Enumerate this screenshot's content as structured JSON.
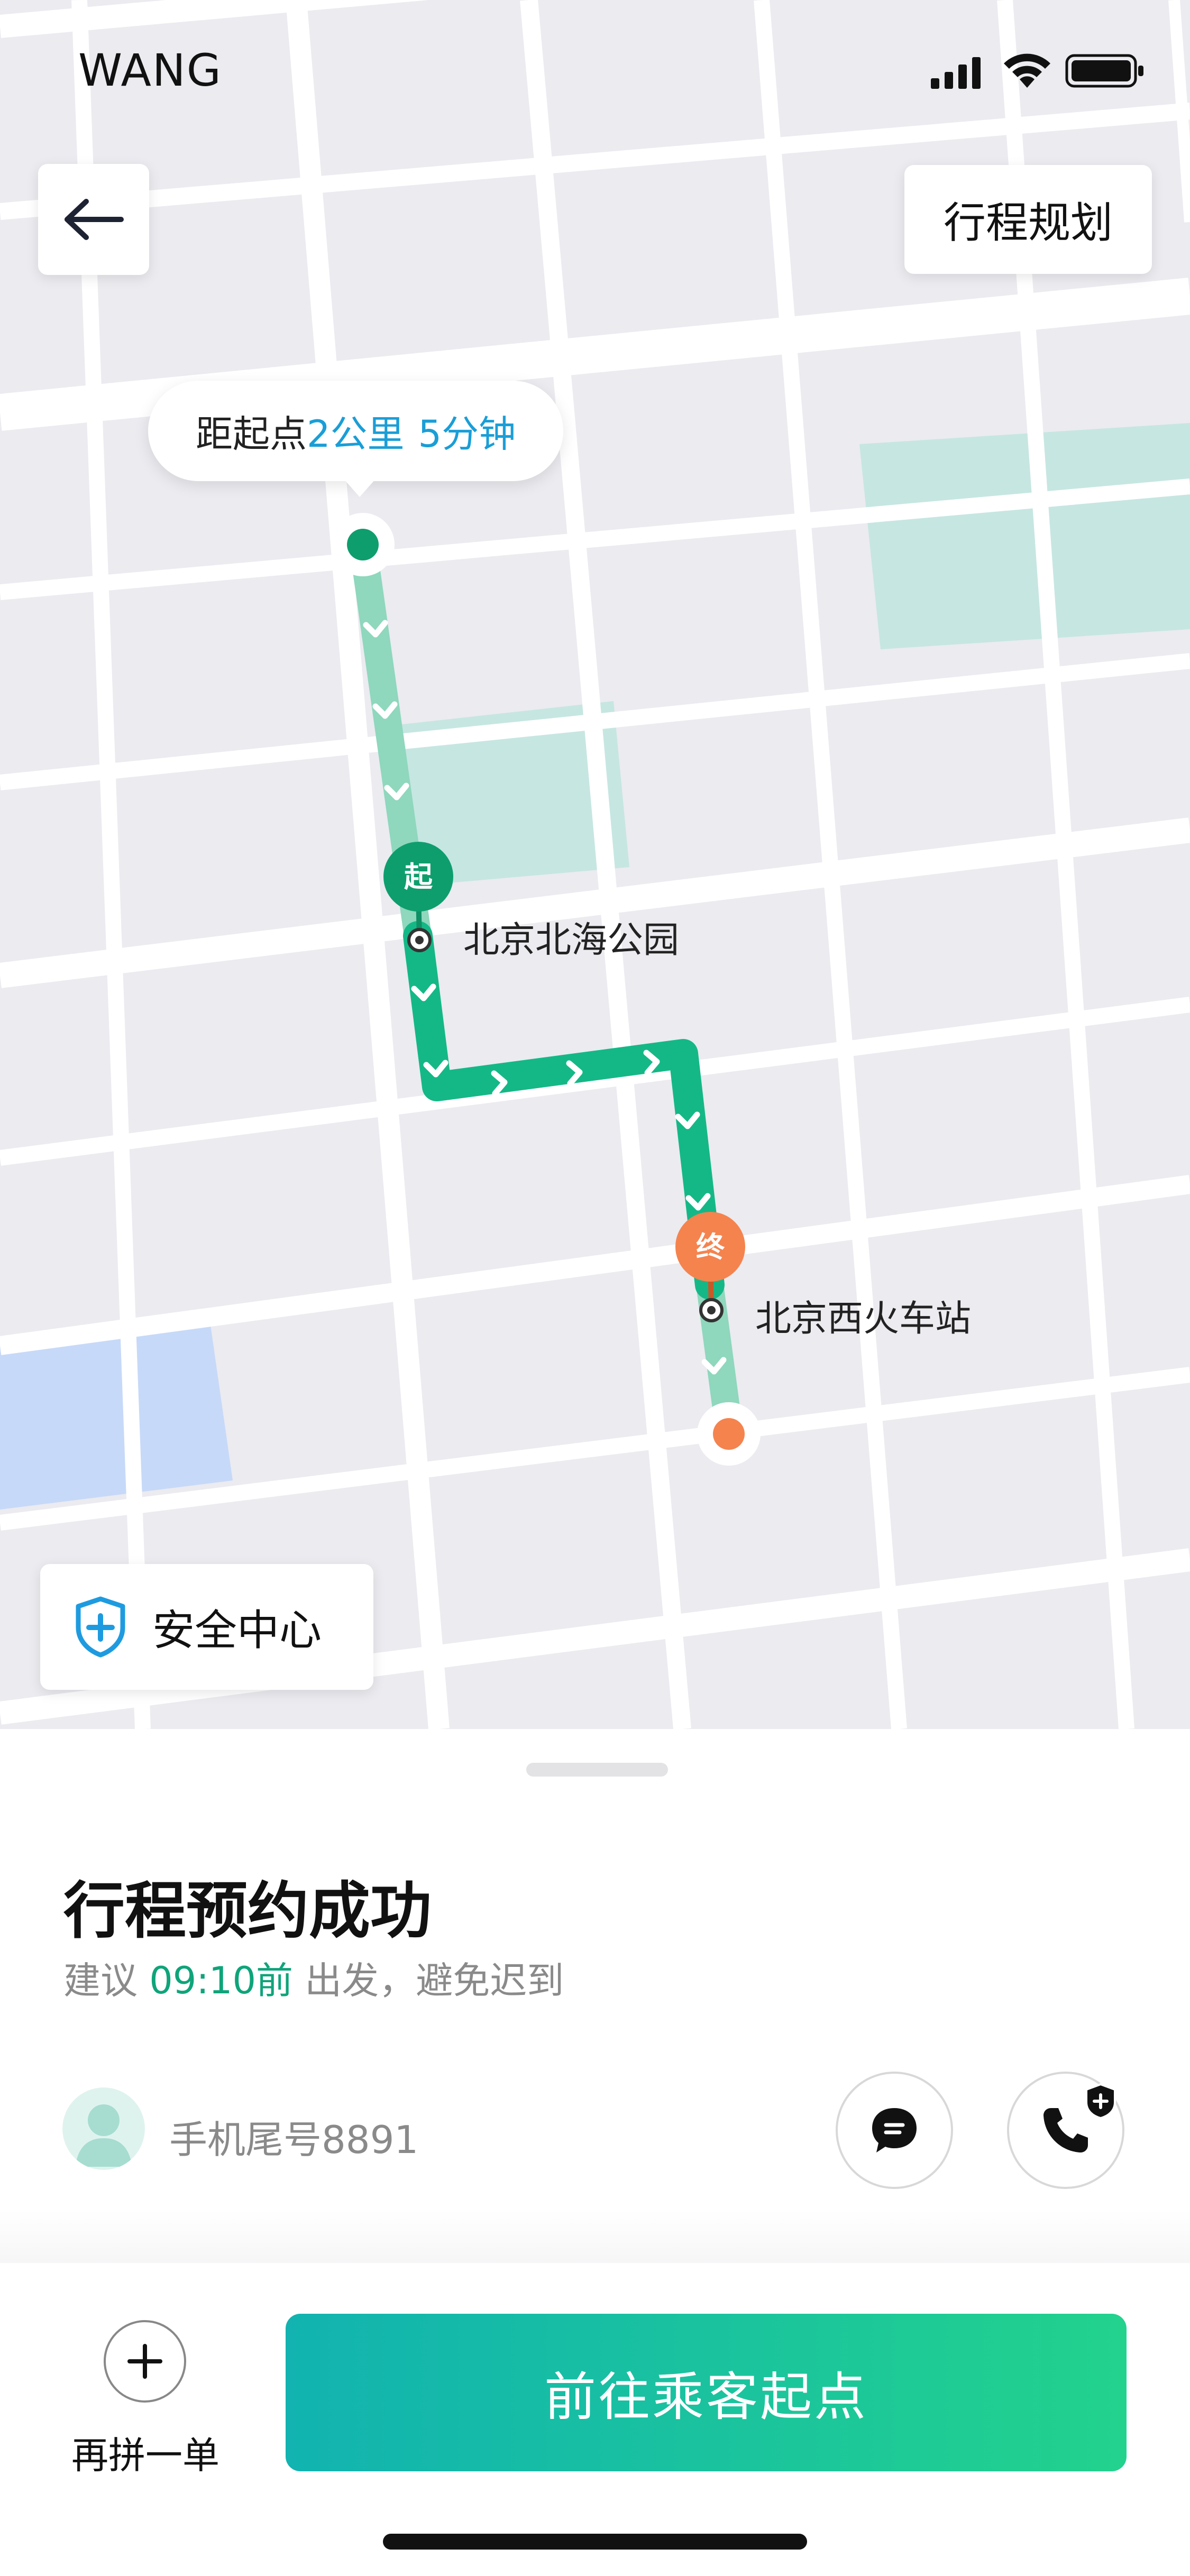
{
  "status_bar": {
    "carrier": "WANG"
  },
  "header": {
    "plan_label": "行程规划"
  },
  "distance_bubble": {
    "prefix": "距起点",
    "distance": "2公里",
    "duration": "5分钟"
  },
  "route": {
    "start": {
      "marker": "起",
      "name": "北京北海公园"
    },
    "end": {
      "marker": "终",
      "name": "北京西火车站"
    }
  },
  "safety": {
    "label": "安全中心"
  },
  "trip": {
    "title": "行程预约成功",
    "advice_prefix": "建议",
    "depart_time": "09:10前",
    "advice_suffix": "出发，避免迟到",
    "passenger": "手机尾号8891"
  },
  "actions": {
    "add_label": "再拼一单",
    "go_label": "前往乘客起点"
  },
  "colors": {
    "route_green": "#14b886",
    "route_light": "#8fd7bd",
    "end_orange": "#f5834e",
    "accent_blue": "#1a9ed7",
    "safety_blue": "#1e9be0"
  },
  "icons": [
    "back-arrow-icon",
    "signal-icon",
    "wifi-icon",
    "battery-icon",
    "shield-plus-icon",
    "message-icon",
    "phone-icon",
    "plus-icon"
  ]
}
